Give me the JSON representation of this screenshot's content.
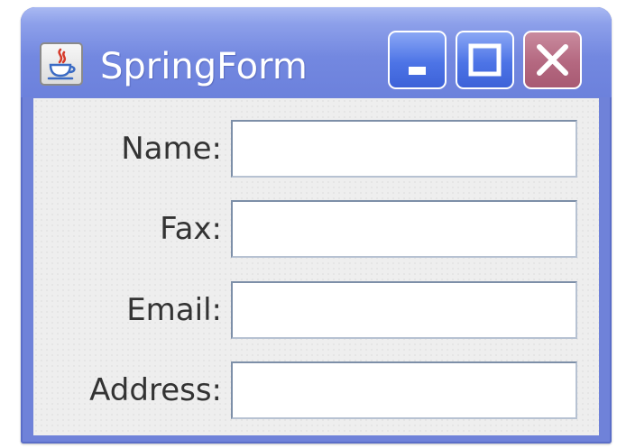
{
  "window": {
    "title": "SpringForm",
    "app_icon": "java-cup-icon",
    "controls": {
      "minimize": "minimize-icon",
      "maximize": "maximize-icon",
      "close": "close-icon"
    },
    "colors": {
      "titlebar": "#7388e0",
      "close_button": "#b46880",
      "control_buttons": "#4d74e6",
      "content_background": "#eeeeee"
    }
  },
  "form": {
    "fields": [
      {
        "label": "Name:",
        "value": ""
      },
      {
        "label": "Fax:",
        "value": ""
      },
      {
        "label": "Email:",
        "value": ""
      },
      {
        "label": "Address:",
        "value": ""
      }
    ]
  }
}
